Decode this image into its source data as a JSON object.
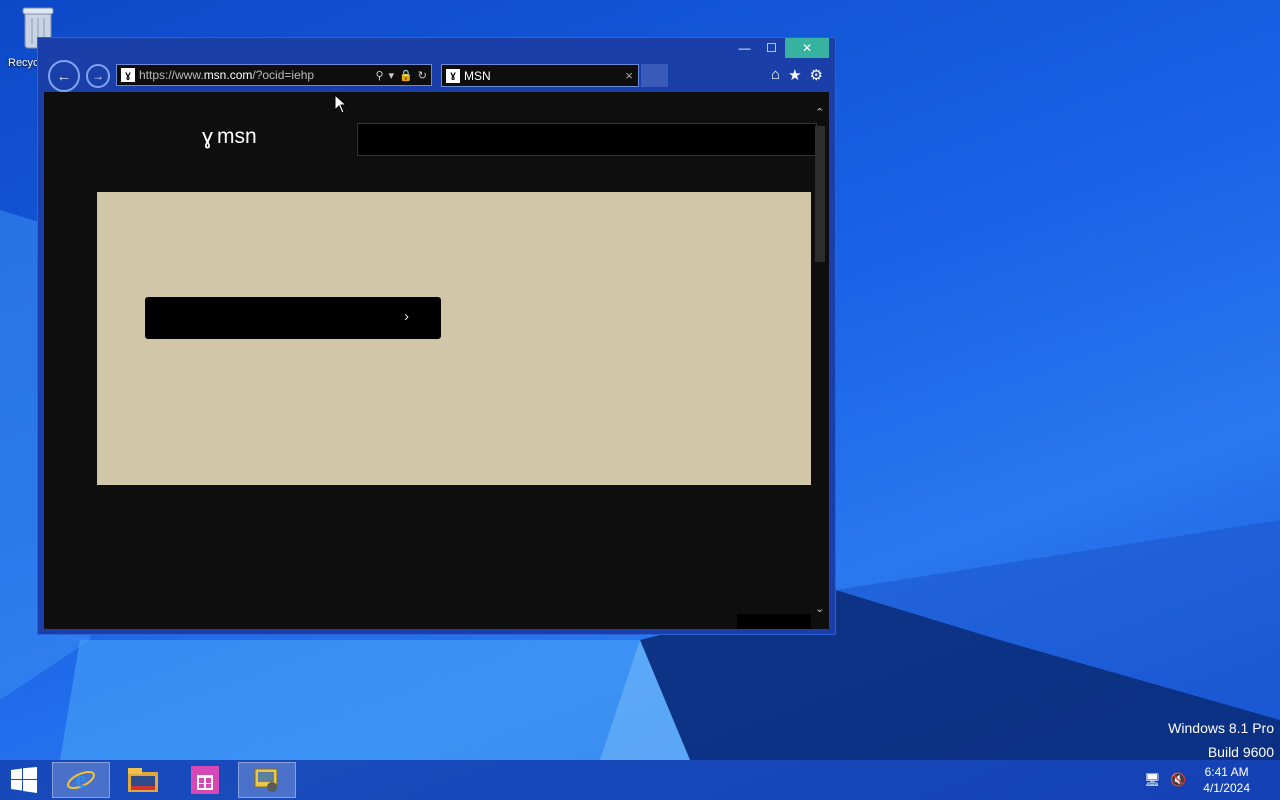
{
  "desktop": {
    "recycle_bin_label": "Recyc",
    "watermark_line1": "Windows 8.1 Pro",
    "watermark_line2": "Build 9600"
  },
  "browser": {
    "url_prefix": "https://www.",
    "url_domain": "msn.com",
    "url_suffix": "/?ocid=iehp",
    "tab_title": "MSN",
    "tab_close": "×",
    "minimize": "—",
    "maximize": "☐",
    "close": "✕"
  },
  "page": {
    "logo_text": "msn",
    "hero_chevron": "›"
  },
  "taskbar": {
    "time": "6:41 AM",
    "date": "4/1/2024"
  },
  "colors": {
    "close_button": "#38b2a0",
    "hero_background": "#d2c6a8",
    "page_background": "#0e0e0e"
  }
}
